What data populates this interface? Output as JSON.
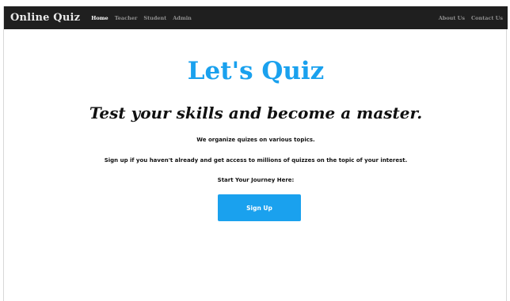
{
  "navbar": {
    "brand": "Online Quiz",
    "left_links": [
      "Home",
      "Teacher",
      "Student",
      "Admin"
    ],
    "right_links": [
      "About Us",
      "Contact Us"
    ],
    "active": "Home"
  },
  "hero": {
    "title": "Let's Quiz",
    "tagline": "Test your skills and become a master.",
    "line1": "We organize quizes on various topics.",
    "line2": "Sign up if you haven't already and get access to millions of quizzes on the topic of your interest.",
    "line3": "Start Your Journey Here:",
    "signup_label": "Sign Up"
  },
  "colors": {
    "navbar_bg": "#1f1f1f",
    "accent": "#1aa1ee",
    "text": "#111111"
  }
}
